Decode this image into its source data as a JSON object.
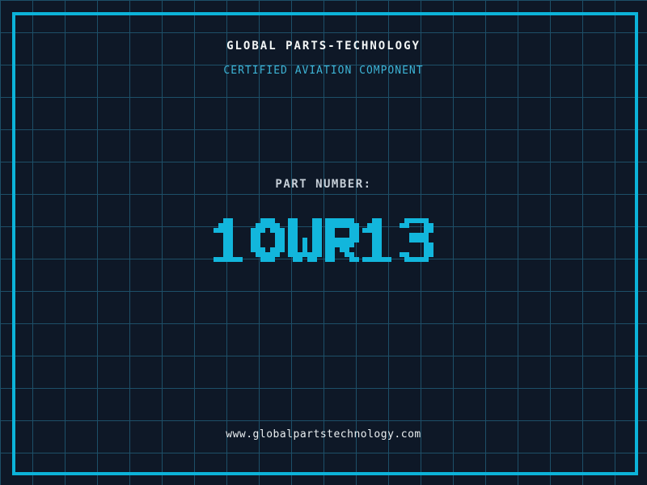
{
  "label": {
    "company": "GLOBAL PARTS-TECHNOLOGY",
    "certification": "CERTIFIED AVIATION COMPONENT",
    "part_number_label": "PART NUMBER:",
    "part_number": "10WR13",
    "website": "www.globalpartstechnology.com"
  },
  "colors": {
    "background": "#0e1827",
    "grid_line": "#1d4f68",
    "frame": "#0cb3d9",
    "accent_cyan": "#12b6dc",
    "subtitle_cyan": "#3db4d6",
    "title_white": "#f2f5f5",
    "part_label_gray": "#c5ced7",
    "url_white": "#e9eef0"
  },
  "style": {
    "grid_spacing_px": 40,
    "frame_border_px": 4
  }
}
